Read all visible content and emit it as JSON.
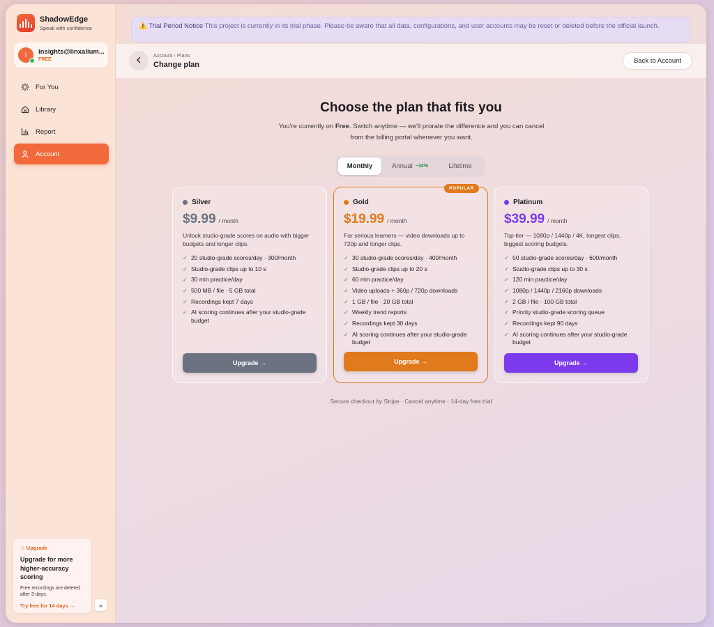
{
  "brand": {
    "name": "ShadowEdge",
    "tagline": "Speak with confidence"
  },
  "user": {
    "initial": "I",
    "email": "insights@linxalium...",
    "plan": "FREE"
  },
  "nav": [
    {
      "label": "For You",
      "icon": "sparkle-icon",
      "active": false
    },
    {
      "label": "Library",
      "icon": "home-icon",
      "active": false
    },
    {
      "label": "Report",
      "icon": "bar-chart-icon",
      "active": false
    },
    {
      "label": "Account",
      "icon": "user-icon",
      "active": true
    }
  ],
  "upgrade_card": {
    "kicker": "☆ Upgrade",
    "title": "Upgrade for more higher-accuracy scoring",
    "desc": "Free recordings are deleted after 3 days.",
    "cta": "Try free for 14 days →"
  },
  "collapse_label": "«",
  "notice": {
    "icon": "⚠️",
    "title": "Trial Period Notice",
    "text": "This project is currently in its trial phase. Please be aware that all data, configurations, and user accounts may be reset or deleted before the official launch."
  },
  "header": {
    "breadcrumb": "Account › Plans",
    "title": "Change plan",
    "back_label": "Back to Account"
  },
  "hero": {
    "title": "Choose the plan that fits you",
    "sub_prefix": "You're currently on ",
    "sub_plan": "Free",
    "sub_suffix": ". Switch anytime — we'll prorate the difference and you can cancel from the billing portal whenever you want."
  },
  "billing_toggle": {
    "monthly": "Monthly",
    "annual": "Annual",
    "annual_save": "−34%",
    "lifetime": "Lifetime",
    "selected": "Monthly"
  },
  "plans": [
    {
      "name": "Silver",
      "color": "#6b7280",
      "price": "$9.99",
      "per": "/ month",
      "desc": "Unlock studio-grade scores on audio with bigger budgets and longer clips.",
      "features": [
        "20 studio-grade scores/day · 300/month",
        "Studio-grade clips up to 10 s",
        "30 min practice/day",
        "500 MB / file · 5 GB total",
        "Recordings kept 7 days",
        "AI scoring continues after your studio-grade budget"
      ],
      "cta": "Upgrade →",
      "popular": false
    },
    {
      "name": "Gold",
      "color": "#e07a1d",
      "price": "$19.99",
      "per": "/ month",
      "desc": "For serious learners — video downloads up to 720p and longer clips.",
      "features": [
        "30 studio-grade scores/day · 400/month",
        "Studio-grade clips up to 20 s",
        "60 min practice/day",
        "Video uploads + 360p / 720p downloads",
        "1 GB / file · 20 GB total",
        "Weekly trend reports",
        "Recordings kept 30 days",
        "AI scoring continues after your studio-grade budget"
      ],
      "cta": "Upgrade →",
      "popular": true,
      "badge": "POPULAR"
    },
    {
      "name": "Platinum",
      "color": "#7c3aed",
      "price": "$39.99",
      "per": "/ month",
      "desc": "Top-tier — 1080p / 1440p / 4K, longest clips, biggest scoring budgets.",
      "features": [
        "50 studio-grade scores/day · 600/month",
        "Studio-grade clips up to 30 s",
        "120 min practice/day",
        "1080p / 1440p / 2160p downloads",
        "2 GB / file · 100 GB total",
        "Priority studio-grade scoring queue",
        "Recordings kept 90 days",
        "AI scoring continues after your studio-grade budget"
      ],
      "cta": "Upgrade →",
      "popular": false
    }
  ],
  "footer_note": "Secure checkout by Stripe · Cancel anytime · 14-day free trial"
}
